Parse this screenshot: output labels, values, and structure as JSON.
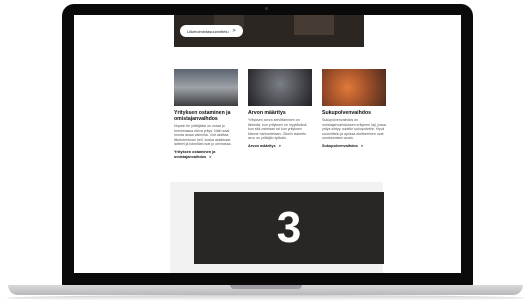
{
  "hero": {
    "button_label": "Liiketoimintasuunnittelu",
    "chevron": ">"
  },
  "cards": [
    {
      "title": "Yrityksen ostaminen ja omistajanvaihdos",
      "body": "Nopein tie yrittäjäksi on ostaa jo toiminnassa oleva yritys. Näin saat monta asiaa valmiina. Voit aloittaa liiketoiminnan heti, koska asiakkaat, laitteet ja toimitilat ovat jo olemassa.",
      "link": "Yrityksen ostaminen ja omistajanvaihdos",
      "icon": "photo-workshop"
    },
    {
      "title": "Arvon määritys",
      "body": "Yrityksen arvon selvittäminen on tärkeää, kun yrityksen on myytävänä, kun sitä ostetaan tai kun yrityksen tilanne hahmotetaan. Oikein laskettu arvo on yrittäjän työkalu.",
      "link": "Arvon määritys",
      "icon": "photo-valuation"
    },
    {
      "title": "Sukupolvenvaihdos",
      "body": "Sukupolvenvaihdos on omistajanvaihdoksen erityinen laji, jossa yritys siirtyy uudelle sukupolvelle. Hyvä suunnittelu ja ajoissa aloittaminen ovat onnistumisen avain.",
      "link": "Sukupolvenvaihdos",
      "icon": "photo-generation"
    }
  ],
  "video": {
    "number": "3"
  }
}
